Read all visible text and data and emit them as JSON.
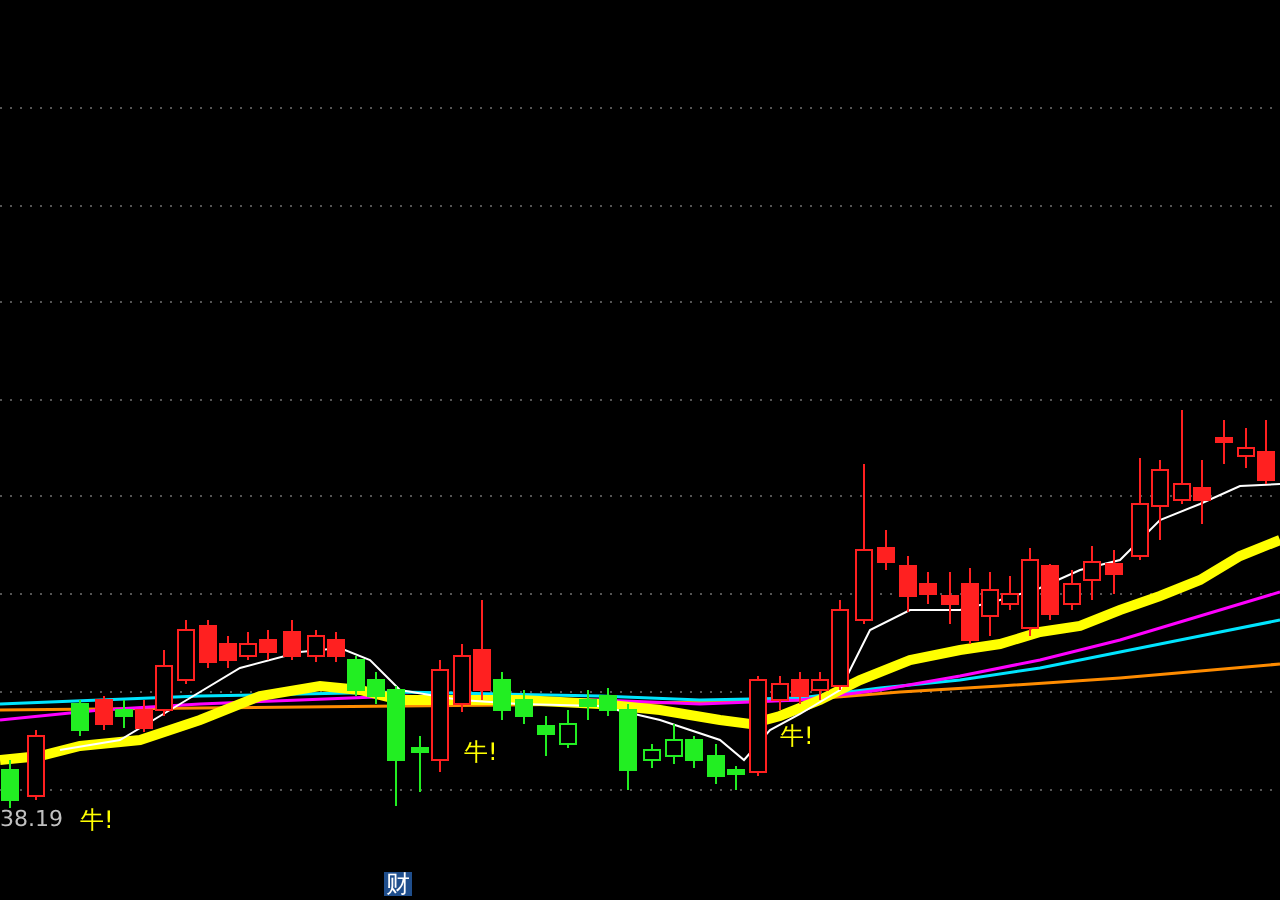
{
  "price_label": "38.19",
  "signals": [
    {
      "label": "牛!"
    },
    {
      "label": "牛!"
    },
    {
      "label": "牛!"
    }
  ],
  "footer_badge": "财"
}
